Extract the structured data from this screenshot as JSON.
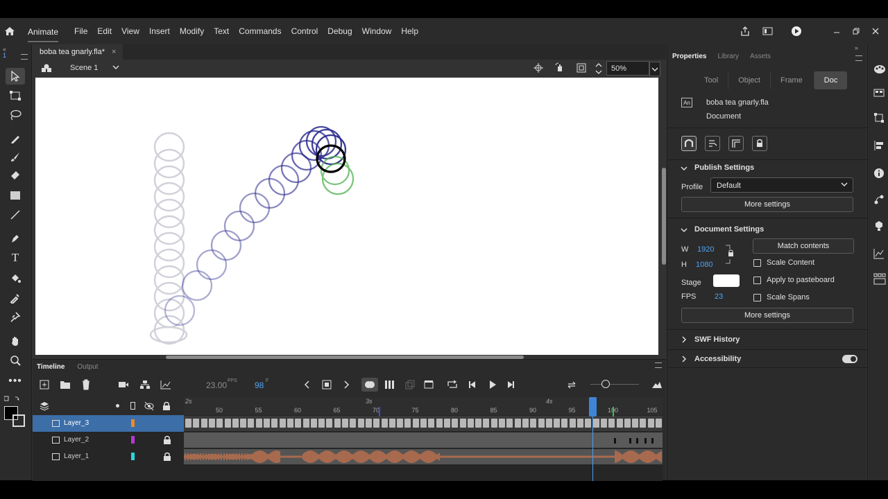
{
  "app": {
    "name": "Animate",
    "menu": [
      "File",
      "Edit",
      "View",
      "Insert",
      "Modify",
      "Text",
      "Commands",
      "Control",
      "Debug",
      "Window",
      "Help"
    ]
  },
  "document": {
    "tab_title": "boba tea gnarly.fla*",
    "scene": "Scene 1",
    "zoom": "50%"
  },
  "timeline": {
    "tabs": [
      "Timeline",
      "Output"
    ],
    "fps": "23.00",
    "fps_unit": "FPS",
    "frame": "98",
    "frame_unit": "F",
    "seconds_marks": [
      "2s",
      "3s",
      "4s"
    ],
    "frame_ticks": [
      "50",
      "55",
      "60",
      "65",
      "70",
      "75",
      "80",
      "85",
      "90",
      "95",
      "100",
      "105"
    ],
    "layers": [
      {
        "name": "Layer_3",
        "color": "#f08a24",
        "locked": false,
        "selected": true
      },
      {
        "name": "Layer_2",
        "color": "#b43ad1",
        "locked": true,
        "selected": false
      },
      {
        "name": "Layer_1",
        "color": "#29d6e0",
        "locked": true,
        "selected": false
      }
    ]
  },
  "properties": {
    "tabs": [
      "Properties",
      "Library",
      "Assets"
    ],
    "subtabs": [
      "Tool",
      "Object",
      "Frame",
      "Doc"
    ],
    "active_subtab": "Doc",
    "doc_name": "boba tea gnarly.fla",
    "doc_type": "Document",
    "doc_icon": "An",
    "publish": {
      "title": "Publish Settings",
      "profile_label": "Profile",
      "profile_value": "Default",
      "more": "More settings"
    },
    "docsettings": {
      "title": "Document Settings",
      "w_label": "W",
      "w_value": "1920",
      "h_label": "H",
      "h_value": "1080",
      "match": "Match contents",
      "scale_content": "Scale Content",
      "stage_label": "Stage",
      "apply_pasteboard": "Apply to pasteboard",
      "fps_label": "FPS",
      "fps_value": "23",
      "scale_spans": "Scale Spans",
      "more": "More settings"
    },
    "swf_history": "SWF History",
    "accessibility": "Accessibility"
  }
}
